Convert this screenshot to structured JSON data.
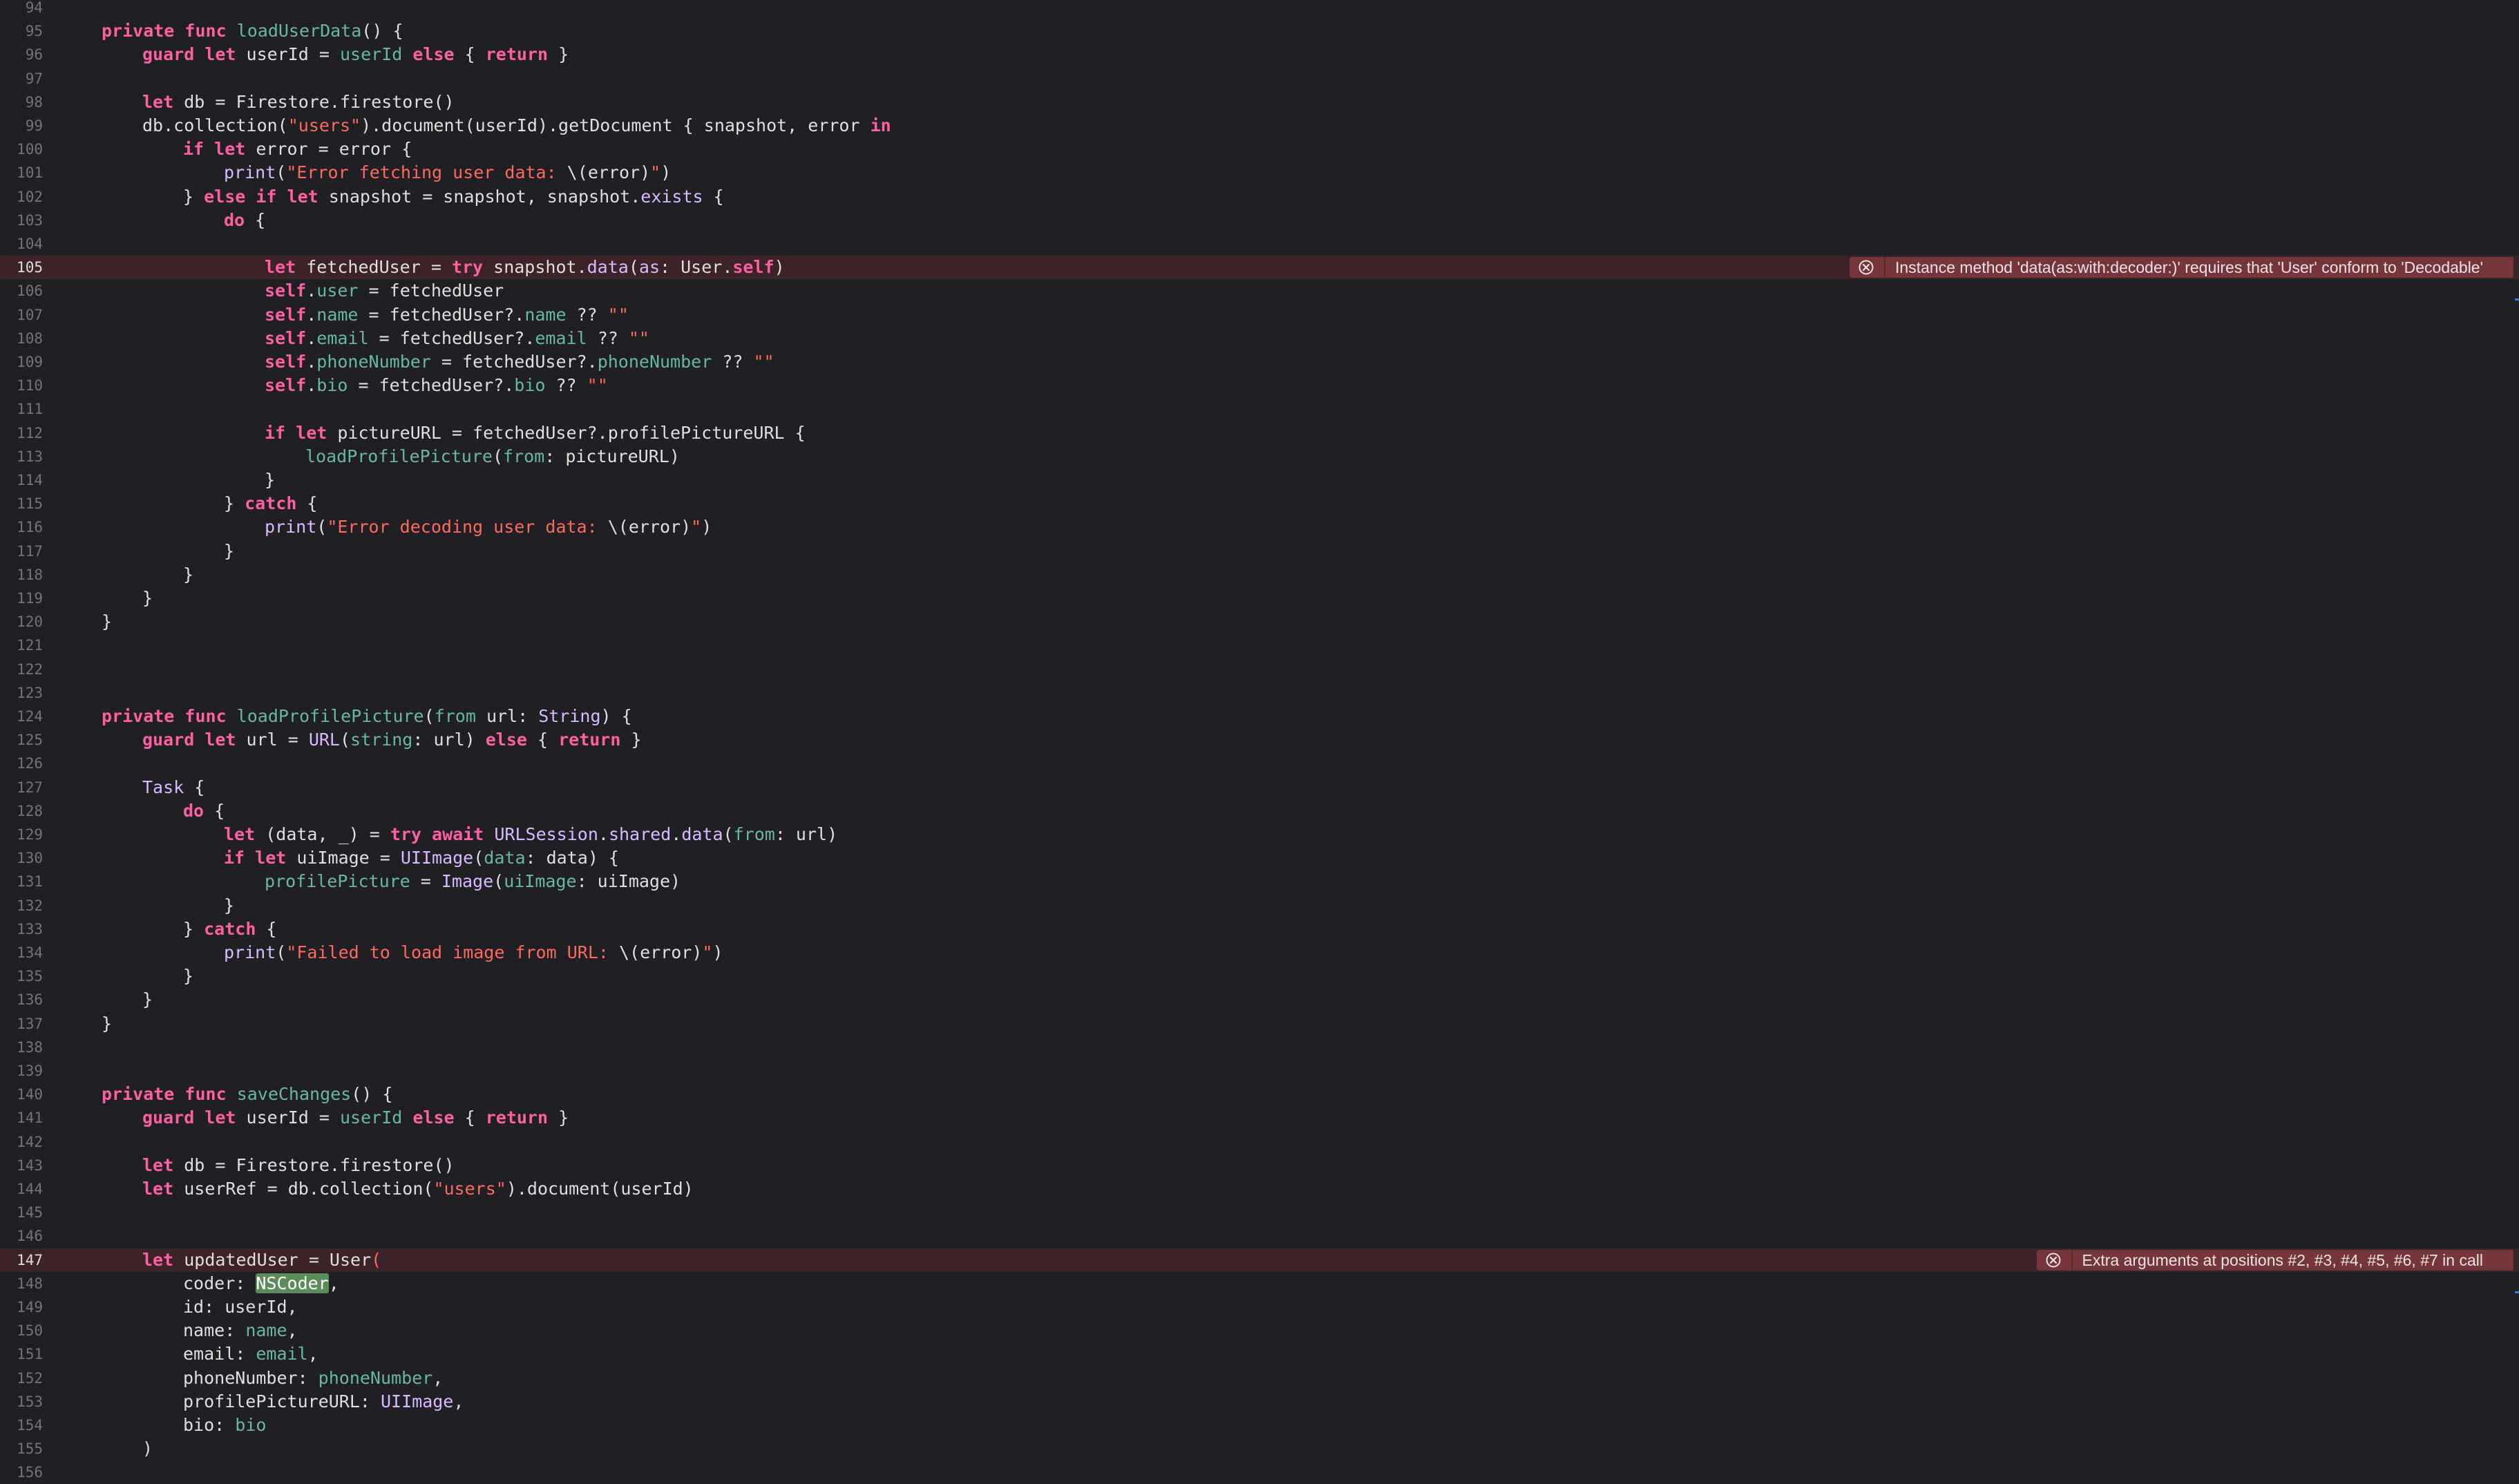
{
  "editor": {
    "lines": [
      {
        "n": "94",
        "tokens": []
      },
      {
        "n": "95",
        "tokens": [
          [
            "kw",
            "private func "
          ],
          [
            "fn",
            "loadUserData"
          ],
          [
            "plain",
            "() {"
          ]
        ],
        "indent": 0
      },
      {
        "n": "96",
        "tokens": [
          [
            "kw",
            "guard let "
          ],
          [
            "plain",
            "userId = "
          ],
          [
            "prop",
            "userId"
          ],
          [
            "kw",
            " else "
          ],
          [
            "plain",
            "{ "
          ],
          [
            "kw",
            "return"
          ],
          [
            "plain",
            " }"
          ]
        ],
        "indent": 1
      },
      {
        "n": "97",
        "tokens": []
      },
      {
        "n": "98",
        "tokens": [
          [
            "kw",
            "let "
          ],
          [
            "plain",
            "db = Firestore.firestore()"
          ]
        ],
        "indent": 1
      },
      {
        "n": "99",
        "tokens": [
          [
            "plain",
            "db.collection("
          ],
          [
            "str",
            "\"users\""
          ],
          [
            "plain",
            ").document(userId).getDocument { snapshot, error "
          ],
          [
            "kw",
            "in"
          ]
        ],
        "indent": 1
      },
      {
        "n": "100",
        "tokens": [
          [
            "kw",
            "if let "
          ],
          [
            "plain",
            "error = error {"
          ]
        ],
        "indent": 2
      },
      {
        "n": "101",
        "tokens": [
          [
            "ty",
            "print"
          ],
          [
            "plain",
            "("
          ],
          [
            "str",
            "\"Error fetching user data: "
          ],
          [
            "plain",
            "\\(error)"
          ],
          [
            "str",
            "\""
          ],
          [
            "plain",
            ")"
          ]
        ],
        "indent": 3
      },
      {
        "n": "102",
        "tokens": [
          [
            "plain",
            "} "
          ],
          [
            "kw",
            "else if let "
          ],
          [
            "plain",
            "snapshot = snapshot, snapshot."
          ],
          [
            "ty",
            "exists"
          ],
          [
            "plain",
            " {"
          ]
        ],
        "indent": 2
      },
      {
        "n": "103",
        "tokens": [
          [
            "kw",
            "do "
          ],
          [
            "plain",
            "{"
          ]
        ],
        "indent": 3
      },
      {
        "n": "104",
        "tokens": []
      },
      {
        "n": "105",
        "tokens": [
          [
            "kw",
            "let "
          ],
          [
            "plain",
            "fetchedUser = "
          ],
          [
            "kw",
            "try "
          ],
          [
            "plain",
            "snapshot."
          ],
          [
            "ty",
            "data"
          ],
          [
            "plain",
            "("
          ],
          [
            "ty",
            "as"
          ],
          [
            "plain",
            ": User."
          ],
          [
            "kw",
            "self"
          ],
          [
            "plain",
            ")"
          ]
        ],
        "indent": 4,
        "error": "Instance method 'data(as:with:decoder:)' requires that 'User' conform to 'Decodable'"
      },
      {
        "n": "106",
        "tokens": [
          [
            "kw",
            "self"
          ],
          [
            "plain",
            "."
          ],
          [
            "prop",
            "user"
          ],
          [
            "plain",
            " = fetchedUser"
          ]
        ],
        "indent": 4
      },
      {
        "n": "107",
        "tokens": [
          [
            "kw",
            "self"
          ],
          [
            "plain",
            "."
          ],
          [
            "prop",
            "name"
          ],
          [
            "plain",
            " = fetchedUser?."
          ],
          [
            "prop",
            "name"
          ],
          [
            "plain",
            " ?? "
          ],
          [
            "str",
            "\"\""
          ]
        ],
        "indent": 4
      },
      {
        "n": "108",
        "tokens": [
          [
            "kw",
            "self"
          ],
          [
            "plain",
            "."
          ],
          [
            "prop",
            "email"
          ],
          [
            "plain",
            " = fetchedUser?."
          ],
          [
            "prop",
            "email"
          ],
          [
            "plain",
            " ?? "
          ],
          [
            "str",
            "\"\""
          ]
        ],
        "indent": 4
      },
      {
        "n": "109",
        "tokens": [
          [
            "kw",
            "self"
          ],
          [
            "plain",
            "."
          ],
          [
            "prop",
            "phoneNumber"
          ],
          [
            "plain",
            " = fetchedUser?."
          ],
          [
            "prop",
            "phoneNumber"
          ],
          [
            "plain",
            " ?? "
          ],
          [
            "str",
            "\"\""
          ]
        ],
        "indent": 4
      },
      {
        "n": "110",
        "tokens": [
          [
            "kw",
            "self"
          ],
          [
            "plain",
            "."
          ],
          [
            "prop",
            "bio"
          ],
          [
            "plain",
            " = fetchedUser?."
          ],
          [
            "prop",
            "bio"
          ],
          [
            "plain",
            " ?? "
          ],
          [
            "str",
            "\"\""
          ]
        ],
        "indent": 4
      },
      {
        "n": "111",
        "tokens": []
      },
      {
        "n": "112",
        "tokens": [
          [
            "kw",
            "if let "
          ],
          [
            "plain",
            "pictureURL = fetchedUser?.profilePictureURL {"
          ]
        ],
        "indent": 4
      },
      {
        "n": "113",
        "tokens": [
          [
            "fn",
            "loadProfilePicture"
          ],
          [
            "plain",
            "("
          ],
          [
            "fn",
            "from"
          ],
          [
            "plain",
            ": pictureURL)"
          ]
        ],
        "indent": 5
      },
      {
        "n": "114",
        "tokens": [
          [
            "plain",
            "}"
          ]
        ],
        "indent": 4
      },
      {
        "n": "115",
        "tokens": [
          [
            "plain",
            "} "
          ],
          [
            "kw",
            "catch "
          ],
          [
            "plain",
            "{"
          ]
        ],
        "indent": 3
      },
      {
        "n": "116",
        "tokens": [
          [
            "ty",
            "print"
          ],
          [
            "plain",
            "("
          ],
          [
            "str",
            "\"Error decoding user data: "
          ],
          [
            "plain",
            "\\(error)"
          ],
          [
            "str",
            "\""
          ],
          [
            "plain",
            ")"
          ]
        ],
        "indent": 4
      },
      {
        "n": "117",
        "tokens": [
          [
            "plain",
            "}"
          ]
        ],
        "indent": 3
      },
      {
        "n": "118",
        "tokens": [
          [
            "plain",
            "}"
          ]
        ],
        "indent": 2
      },
      {
        "n": "119",
        "tokens": [
          [
            "plain",
            "}"
          ]
        ],
        "indent": 1
      },
      {
        "n": "120",
        "tokens": [
          [
            "plain",
            "}"
          ]
        ],
        "indent": 0
      },
      {
        "n": "121",
        "tokens": []
      },
      {
        "n": "122",
        "tokens": []
      },
      {
        "n": "123",
        "tokens": []
      },
      {
        "n": "124",
        "tokens": [
          [
            "kw",
            "private func "
          ],
          [
            "fn",
            "loadProfilePicture"
          ],
          [
            "plain",
            "("
          ],
          [
            "fn",
            "from"
          ],
          [
            "plain",
            " url: "
          ],
          [
            "ty",
            "String"
          ],
          [
            "plain",
            ") {"
          ]
        ],
        "indent": 0
      },
      {
        "n": "125",
        "tokens": [
          [
            "kw",
            "guard let "
          ],
          [
            "plain",
            "url = "
          ],
          [
            "ty",
            "URL"
          ],
          [
            "plain",
            "("
          ],
          [
            "fn",
            "string"
          ],
          [
            "plain",
            ": url) "
          ],
          [
            "kw",
            "else "
          ],
          [
            "plain",
            "{ "
          ],
          [
            "kw",
            "return"
          ],
          [
            "plain",
            " }"
          ]
        ],
        "indent": 1
      },
      {
        "n": "126",
        "tokens": []
      },
      {
        "n": "127",
        "tokens": [
          [
            "ty",
            "Task"
          ],
          [
            "plain",
            " {"
          ]
        ],
        "indent": 1
      },
      {
        "n": "128",
        "tokens": [
          [
            "kw",
            "do "
          ],
          [
            "plain",
            "{"
          ]
        ],
        "indent": 2
      },
      {
        "n": "129",
        "tokens": [
          [
            "kw",
            "let "
          ],
          [
            "plain",
            "(data, _) = "
          ],
          [
            "kw",
            "try await "
          ],
          [
            "ty",
            "URLSession"
          ],
          [
            "plain",
            "."
          ],
          [
            "ty",
            "shared"
          ],
          [
            "plain",
            "."
          ],
          [
            "ty",
            "data"
          ],
          [
            "plain",
            "("
          ],
          [
            "fn",
            "from"
          ],
          [
            "plain",
            ": url)"
          ]
        ],
        "indent": 3
      },
      {
        "n": "130",
        "tokens": [
          [
            "kw",
            "if let "
          ],
          [
            "plain",
            "uiImage = "
          ],
          [
            "ty",
            "UIImage"
          ],
          [
            "plain",
            "("
          ],
          [
            "fn",
            "data"
          ],
          [
            "plain",
            ": data) {"
          ]
        ],
        "indent": 3
      },
      {
        "n": "131",
        "tokens": [
          [
            "prop",
            "profilePicture"
          ],
          [
            "plain",
            " = "
          ],
          [
            "ty",
            "Image"
          ],
          [
            "plain",
            "("
          ],
          [
            "fn",
            "uiImage"
          ],
          [
            "plain",
            ": uiImage)"
          ]
        ],
        "indent": 4
      },
      {
        "n": "132",
        "tokens": [
          [
            "plain",
            "}"
          ]
        ],
        "indent": 3
      },
      {
        "n": "133",
        "tokens": [
          [
            "plain",
            "} "
          ],
          [
            "kw",
            "catch "
          ],
          [
            "plain",
            "{"
          ]
        ],
        "indent": 2
      },
      {
        "n": "134",
        "tokens": [
          [
            "ty",
            "print"
          ],
          [
            "plain",
            "("
          ],
          [
            "str",
            "\"Failed to load image from URL: "
          ],
          [
            "plain",
            "\\(error)"
          ],
          [
            "str",
            "\""
          ],
          [
            "plain",
            ")"
          ]
        ],
        "indent": 3
      },
      {
        "n": "135",
        "tokens": [
          [
            "plain",
            "}"
          ]
        ],
        "indent": 2
      },
      {
        "n": "136",
        "tokens": [
          [
            "plain",
            "}"
          ]
        ],
        "indent": 1
      },
      {
        "n": "137",
        "tokens": [
          [
            "plain",
            "}"
          ]
        ],
        "indent": 0
      },
      {
        "n": "138",
        "tokens": []
      },
      {
        "n": "139",
        "tokens": []
      },
      {
        "n": "140",
        "tokens": [
          [
            "kw",
            "private func "
          ],
          [
            "fn",
            "saveChanges"
          ],
          [
            "plain",
            "() {"
          ]
        ],
        "indent": 0
      },
      {
        "n": "141",
        "tokens": [
          [
            "kw",
            "guard let "
          ],
          [
            "plain",
            "userId = "
          ],
          [
            "prop",
            "userId"
          ],
          [
            "kw",
            " else "
          ],
          [
            "plain",
            "{ "
          ],
          [
            "kw",
            "return"
          ],
          [
            "plain",
            " }"
          ]
        ],
        "indent": 1
      },
      {
        "n": "142",
        "tokens": []
      },
      {
        "n": "143",
        "tokens": [
          [
            "kw",
            "let "
          ],
          [
            "plain",
            "db = Firestore.firestore()"
          ]
        ],
        "indent": 1
      },
      {
        "n": "144",
        "tokens": [
          [
            "kw",
            "let "
          ],
          [
            "plain",
            "userRef = db.collection("
          ],
          [
            "str",
            "\"users\""
          ],
          [
            "plain",
            ").document(userId)"
          ]
        ],
        "indent": 1
      },
      {
        "n": "145",
        "tokens": []
      },
      {
        "n": "146",
        "tokens": []
      },
      {
        "n": "147",
        "tokens": [
          [
            "kw",
            "let "
          ],
          [
            "plain",
            "updatedUser = User"
          ],
          [
            "str",
            "("
          ]
        ],
        "indent": 1,
        "error": "Extra arguments at positions #2, #3, #4, #5, #6, #7 in call"
      },
      {
        "n": "148",
        "tokens": [
          [
            "plain",
            "coder: "
          ],
          [
            "hl",
            "NSCoder"
          ],
          [
            "plain",
            ","
          ]
        ],
        "indent": 2
      },
      {
        "n": "149",
        "tokens": [
          [
            "plain",
            "id: userId,"
          ]
        ],
        "indent": 2
      },
      {
        "n": "150",
        "tokens": [
          [
            "plain",
            "name: "
          ],
          [
            "prop",
            "name"
          ],
          [
            "plain",
            ","
          ]
        ],
        "indent": 2
      },
      {
        "n": "151",
        "tokens": [
          [
            "plain",
            "email: "
          ],
          [
            "prop",
            "email"
          ],
          [
            "plain",
            ","
          ]
        ],
        "indent": 2
      },
      {
        "n": "152",
        "tokens": [
          [
            "plain",
            "phoneNumber: "
          ],
          [
            "prop",
            "phoneNumber"
          ],
          [
            "plain",
            ","
          ]
        ],
        "indent": 2
      },
      {
        "n": "153",
        "tokens": [
          [
            "plain",
            "profilePictureURL: "
          ],
          [
            "ty",
            "UIImage"
          ],
          [
            "plain",
            ","
          ]
        ],
        "indent": 2
      },
      {
        "n": "154",
        "tokens": [
          [
            "plain",
            "bio: "
          ],
          [
            "prop",
            "bio"
          ]
        ],
        "indent": 2
      },
      {
        "n": "155",
        "tokens": [
          [
            "plain",
            ")"
          ]
        ],
        "indent": 1
      },
      {
        "n": "156",
        "tokens": []
      }
    ]
  }
}
